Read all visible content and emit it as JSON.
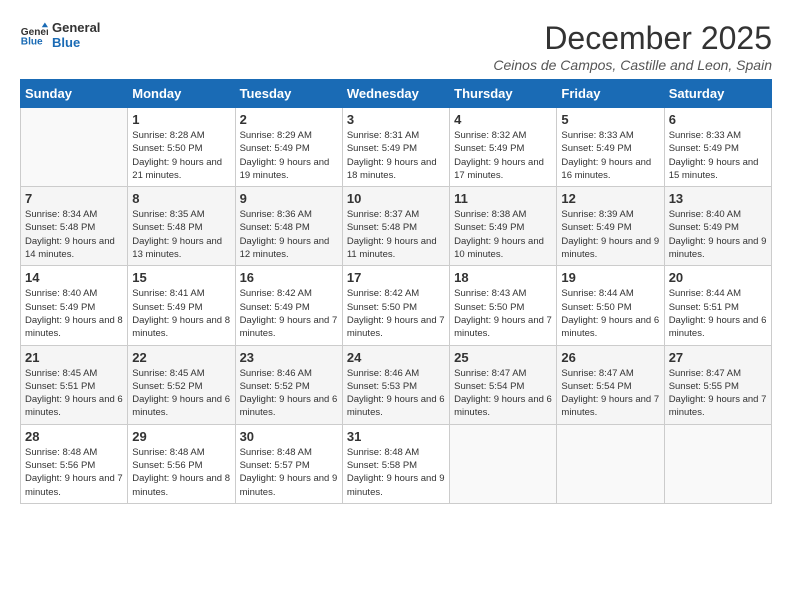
{
  "logo": {
    "text_general": "General",
    "text_blue": "Blue"
  },
  "title": "December 2025",
  "subtitle": "Ceinos de Campos, Castille and Leon, Spain",
  "days_of_week": [
    "Sunday",
    "Monday",
    "Tuesday",
    "Wednesday",
    "Thursday",
    "Friday",
    "Saturday"
  ],
  "weeks": [
    [
      {
        "day": "",
        "sunrise": "",
        "sunset": "",
        "daylight": ""
      },
      {
        "day": "1",
        "sunrise": "Sunrise: 8:28 AM",
        "sunset": "Sunset: 5:50 PM",
        "daylight": "Daylight: 9 hours and 21 minutes."
      },
      {
        "day": "2",
        "sunrise": "Sunrise: 8:29 AM",
        "sunset": "Sunset: 5:49 PM",
        "daylight": "Daylight: 9 hours and 19 minutes."
      },
      {
        "day": "3",
        "sunrise": "Sunrise: 8:31 AM",
        "sunset": "Sunset: 5:49 PM",
        "daylight": "Daylight: 9 hours and 18 minutes."
      },
      {
        "day": "4",
        "sunrise": "Sunrise: 8:32 AM",
        "sunset": "Sunset: 5:49 PM",
        "daylight": "Daylight: 9 hours and 17 minutes."
      },
      {
        "day": "5",
        "sunrise": "Sunrise: 8:33 AM",
        "sunset": "Sunset: 5:49 PM",
        "daylight": "Daylight: 9 hours and 16 minutes."
      },
      {
        "day": "6",
        "sunrise": "Sunrise: 8:33 AM",
        "sunset": "Sunset: 5:49 PM",
        "daylight": "Daylight: 9 hours and 15 minutes."
      }
    ],
    [
      {
        "day": "7",
        "sunrise": "Sunrise: 8:34 AM",
        "sunset": "Sunset: 5:48 PM",
        "daylight": "Daylight: 9 hours and 14 minutes."
      },
      {
        "day": "8",
        "sunrise": "Sunrise: 8:35 AM",
        "sunset": "Sunset: 5:48 PM",
        "daylight": "Daylight: 9 hours and 13 minutes."
      },
      {
        "day": "9",
        "sunrise": "Sunrise: 8:36 AM",
        "sunset": "Sunset: 5:48 PM",
        "daylight": "Daylight: 9 hours and 12 minutes."
      },
      {
        "day": "10",
        "sunrise": "Sunrise: 8:37 AM",
        "sunset": "Sunset: 5:48 PM",
        "daylight": "Daylight: 9 hours and 11 minutes."
      },
      {
        "day": "11",
        "sunrise": "Sunrise: 8:38 AM",
        "sunset": "Sunset: 5:49 PM",
        "daylight": "Daylight: 9 hours and 10 minutes."
      },
      {
        "day": "12",
        "sunrise": "Sunrise: 8:39 AM",
        "sunset": "Sunset: 5:49 PM",
        "daylight": "Daylight: 9 hours and 9 minutes."
      },
      {
        "day": "13",
        "sunrise": "Sunrise: 8:40 AM",
        "sunset": "Sunset: 5:49 PM",
        "daylight": "Daylight: 9 hours and 9 minutes."
      }
    ],
    [
      {
        "day": "14",
        "sunrise": "Sunrise: 8:40 AM",
        "sunset": "Sunset: 5:49 PM",
        "daylight": "Daylight: 9 hours and 8 minutes."
      },
      {
        "day": "15",
        "sunrise": "Sunrise: 8:41 AM",
        "sunset": "Sunset: 5:49 PM",
        "daylight": "Daylight: 9 hours and 8 minutes."
      },
      {
        "day": "16",
        "sunrise": "Sunrise: 8:42 AM",
        "sunset": "Sunset: 5:49 PM",
        "daylight": "Daylight: 9 hours and 7 minutes."
      },
      {
        "day": "17",
        "sunrise": "Sunrise: 8:42 AM",
        "sunset": "Sunset: 5:50 PM",
        "daylight": "Daylight: 9 hours and 7 minutes."
      },
      {
        "day": "18",
        "sunrise": "Sunrise: 8:43 AM",
        "sunset": "Sunset: 5:50 PM",
        "daylight": "Daylight: 9 hours and 7 minutes."
      },
      {
        "day": "19",
        "sunrise": "Sunrise: 8:44 AM",
        "sunset": "Sunset: 5:50 PM",
        "daylight": "Daylight: 9 hours and 6 minutes."
      },
      {
        "day": "20",
        "sunrise": "Sunrise: 8:44 AM",
        "sunset": "Sunset: 5:51 PM",
        "daylight": "Daylight: 9 hours and 6 minutes."
      }
    ],
    [
      {
        "day": "21",
        "sunrise": "Sunrise: 8:45 AM",
        "sunset": "Sunset: 5:51 PM",
        "daylight": "Daylight: 9 hours and 6 minutes."
      },
      {
        "day": "22",
        "sunrise": "Sunrise: 8:45 AM",
        "sunset": "Sunset: 5:52 PM",
        "daylight": "Daylight: 9 hours and 6 minutes."
      },
      {
        "day": "23",
        "sunrise": "Sunrise: 8:46 AM",
        "sunset": "Sunset: 5:52 PM",
        "daylight": "Daylight: 9 hours and 6 minutes."
      },
      {
        "day": "24",
        "sunrise": "Sunrise: 8:46 AM",
        "sunset": "Sunset: 5:53 PM",
        "daylight": "Daylight: 9 hours and 6 minutes."
      },
      {
        "day": "25",
        "sunrise": "Sunrise: 8:47 AM",
        "sunset": "Sunset: 5:54 PM",
        "daylight": "Daylight: 9 hours and 6 minutes."
      },
      {
        "day": "26",
        "sunrise": "Sunrise: 8:47 AM",
        "sunset": "Sunset: 5:54 PM",
        "daylight": "Daylight: 9 hours and 7 minutes."
      },
      {
        "day": "27",
        "sunrise": "Sunrise: 8:47 AM",
        "sunset": "Sunset: 5:55 PM",
        "daylight": "Daylight: 9 hours and 7 minutes."
      }
    ],
    [
      {
        "day": "28",
        "sunrise": "Sunrise: 8:48 AM",
        "sunset": "Sunset: 5:56 PM",
        "daylight": "Daylight: 9 hours and 7 minutes."
      },
      {
        "day": "29",
        "sunrise": "Sunrise: 8:48 AM",
        "sunset": "Sunset: 5:56 PM",
        "daylight": "Daylight: 9 hours and 8 minutes."
      },
      {
        "day": "30",
        "sunrise": "Sunrise: 8:48 AM",
        "sunset": "Sunset: 5:57 PM",
        "daylight": "Daylight: 9 hours and 9 minutes."
      },
      {
        "day": "31",
        "sunrise": "Sunrise: 8:48 AM",
        "sunset": "Sunset: 5:58 PM",
        "daylight": "Daylight: 9 hours and 9 minutes."
      },
      {
        "day": "",
        "sunrise": "",
        "sunset": "",
        "daylight": ""
      },
      {
        "day": "",
        "sunrise": "",
        "sunset": "",
        "daylight": ""
      },
      {
        "day": "",
        "sunrise": "",
        "sunset": "",
        "daylight": ""
      }
    ]
  ]
}
